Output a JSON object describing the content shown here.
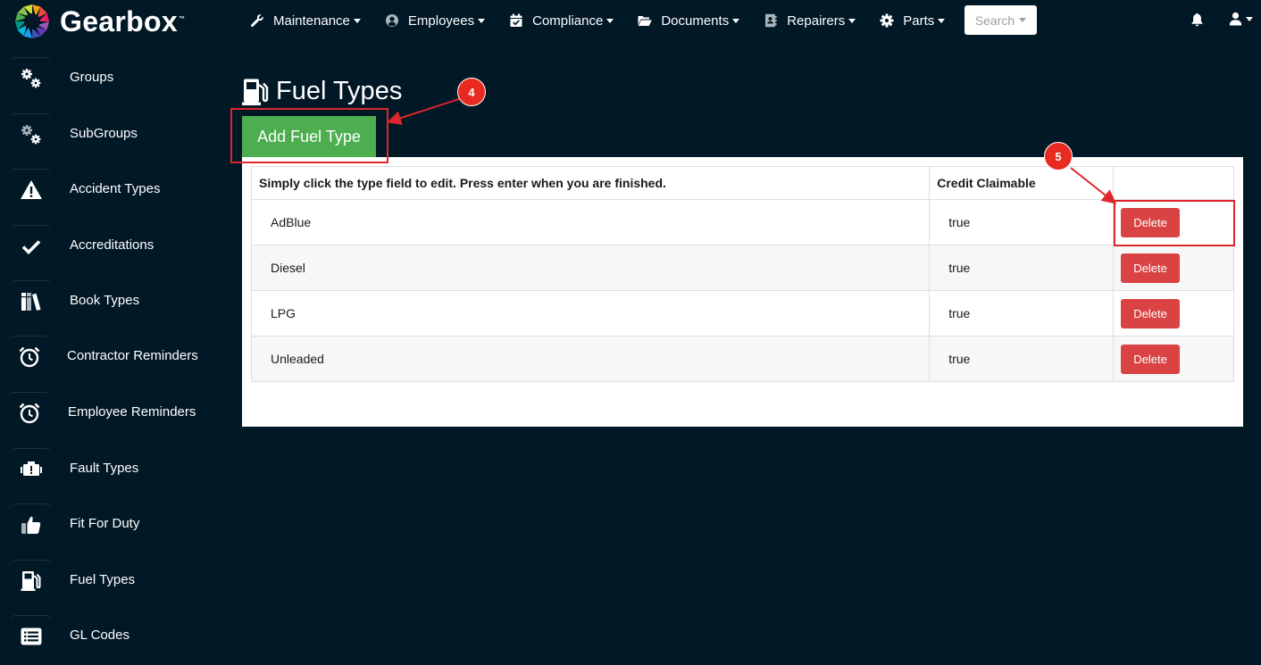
{
  "brand": {
    "name": "Gearbox",
    "trademark": "™"
  },
  "nav": {
    "items": [
      {
        "label": "Maintenance",
        "icon": "wrench-icon"
      },
      {
        "label": "Employees",
        "icon": "user-circle-icon"
      },
      {
        "label": "Compliance",
        "icon": "calendar-check-icon"
      },
      {
        "label": "Documents",
        "icon": "folder-open-icon"
      },
      {
        "label": "Repairers",
        "icon": "address-book-icon"
      },
      {
        "label": "Parts",
        "icon": "gear-icon"
      }
    ],
    "search_label": "Search"
  },
  "sidebar": {
    "items": [
      {
        "label": "Groups",
        "icon": "gears-icon"
      },
      {
        "label": "SubGroups",
        "icon": "gears-icon"
      },
      {
        "label": "Accident Types",
        "icon": "warning-icon"
      },
      {
        "label": "Accreditations",
        "icon": "check-icon"
      },
      {
        "label": "Book Types",
        "icon": "books-icon"
      },
      {
        "label": "Contractor Reminders",
        "icon": "alarm-clock-icon"
      },
      {
        "label": "Employee Reminders",
        "icon": "alarm-clock-icon"
      },
      {
        "label": "Fault Types",
        "icon": "engine-warning-icon"
      },
      {
        "label": "Fit For Duty",
        "icon": "thumbs-up-icon"
      },
      {
        "label": "Fuel Types",
        "icon": "gas-pump-icon"
      },
      {
        "label": "GL Codes",
        "icon": "list-icon"
      }
    ]
  },
  "main": {
    "title": "Fuel Types",
    "title_icon": "gas-pump-icon",
    "add_button_label": "Add Fuel Type",
    "table": {
      "headers": [
        "Simply click the type field to edit. Press enter when you are finished.",
        "Credit Claimable",
        ""
      ],
      "rows": [
        {
          "type": "AdBlue",
          "credit_claimable": "true",
          "action": "Delete"
        },
        {
          "type": "Diesel",
          "credit_claimable": "true",
          "action": "Delete"
        },
        {
          "type": "LPG",
          "credit_claimable": "true",
          "action": "Delete"
        },
        {
          "type": "Unleaded",
          "credit_claimable": "true",
          "action": "Delete"
        }
      ]
    }
  },
  "annotations": [
    {
      "label": "4"
    },
    {
      "label": "5"
    }
  ],
  "colors": {
    "background": "#011826",
    "add_button": "#4cae4f",
    "delete_button": "#d94344",
    "annotation": "#e92a20"
  }
}
